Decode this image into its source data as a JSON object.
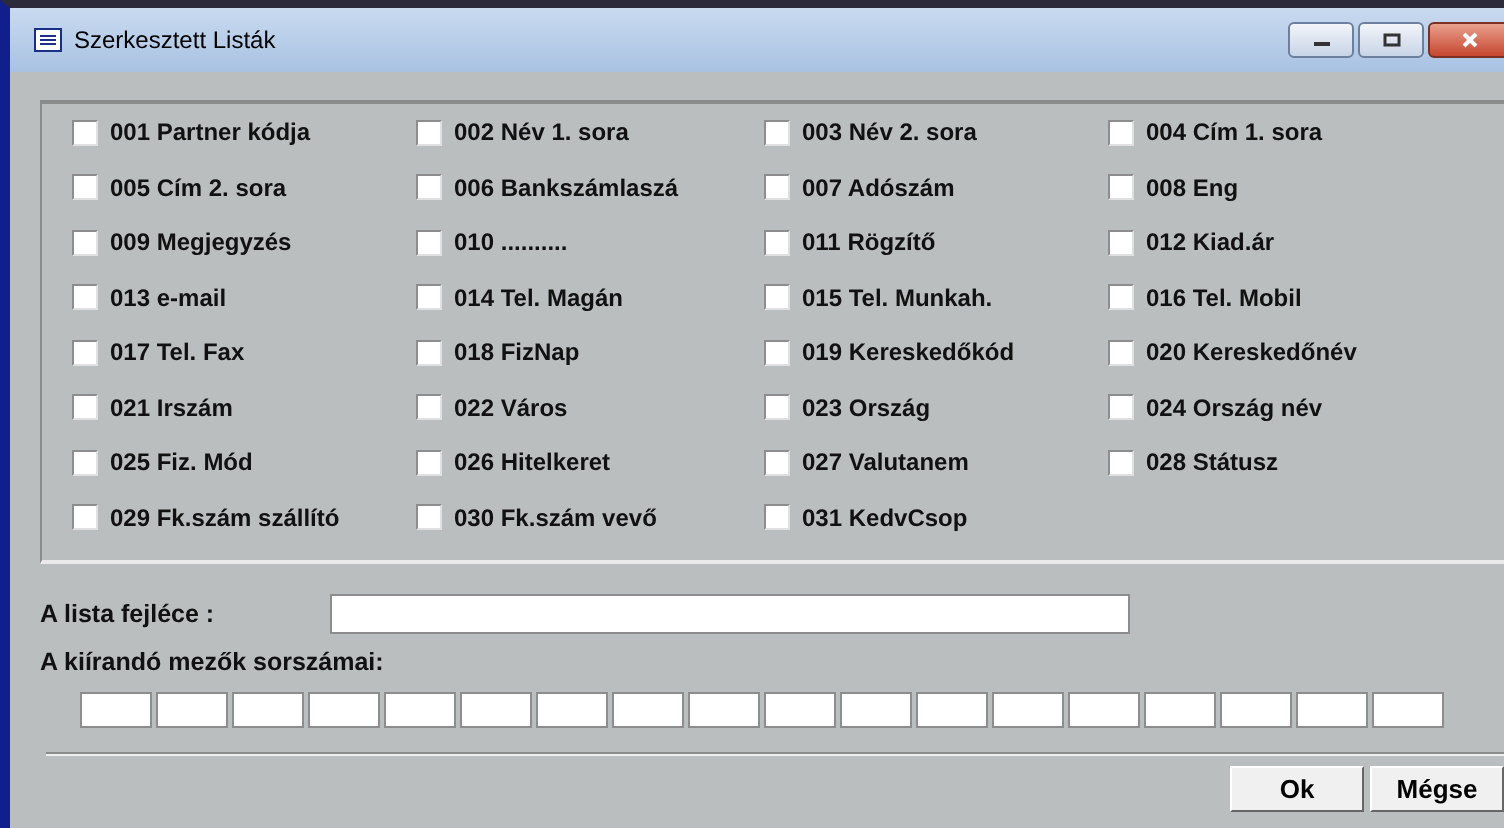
{
  "window": {
    "title": "Szerkesztett Listák"
  },
  "fields": [
    {
      "label": "001 Partner kódja",
      "checked": false
    },
    {
      "label": "002 Név 1. sora",
      "checked": false
    },
    {
      "label": "003 Név 2. sora",
      "checked": false
    },
    {
      "label": "004 Cím 1. sora",
      "checked": false
    },
    {
      "label": "005 Cím 2. sora",
      "checked": false
    },
    {
      "label": "006 Bankszámlaszá",
      "checked": false
    },
    {
      "label": "007 Adószám",
      "checked": false
    },
    {
      "label": "008 Eng",
      "checked": false
    },
    {
      "label": "009 Megjegyzés",
      "checked": false
    },
    {
      "label": "010 ..........",
      "checked": false
    },
    {
      "label": "011 Rögzítő",
      "checked": false
    },
    {
      "label": "012 Kiad.ár",
      "checked": false
    },
    {
      "label": "013 e-mail",
      "checked": false
    },
    {
      "label": "014 Tel. Magán",
      "checked": false
    },
    {
      "label": "015 Tel. Munkah.",
      "checked": false
    },
    {
      "label": "016 Tel. Mobil",
      "checked": false
    },
    {
      "label": "017 Tel. Fax",
      "checked": false
    },
    {
      "label": "018 FizNap",
      "checked": false
    },
    {
      "label": "019 Kereskedőkód",
      "checked": false
    },
    {
      "label": "020 Kereskedőnév",
      "checked": false
    },
    {
      "label": "021 Irszám",
      "checked": false
    },
    {
      "label": "022 Város",
      "checked": false
    },
    {
      "label": "023 Ország",
      "checked": false
    },
    {
      "label": "024 Ország név",
      "checked": false
    },
    {
      "label": "025 Fiz. Mód",
      "checked": false
    },
    {
      "label": "026 Hitelkeret",
      "checked": false
    },
    {
      "label": "027 Valutanem",
      "checked": false
    },
    {
      "label": "028 Státusz",
      "checked": false
    },
    {
      "label": "029 Fk.szám szállító",
      "checked": false
    },
    {
      "label": "030 Fk.szám vevő",
      "checked": false
    },
    {
      "label": "031 KedvCsop",
      "checked": false
    }
  ],
  "list_header": {
    "label": "A lista fejléce :"
  },
  "field_numbers": {
    "label": "A kiírandó mezők sorszámai:"
  },
  "buttons": [
    "Ok",
    "Mégse"
  ]
}
